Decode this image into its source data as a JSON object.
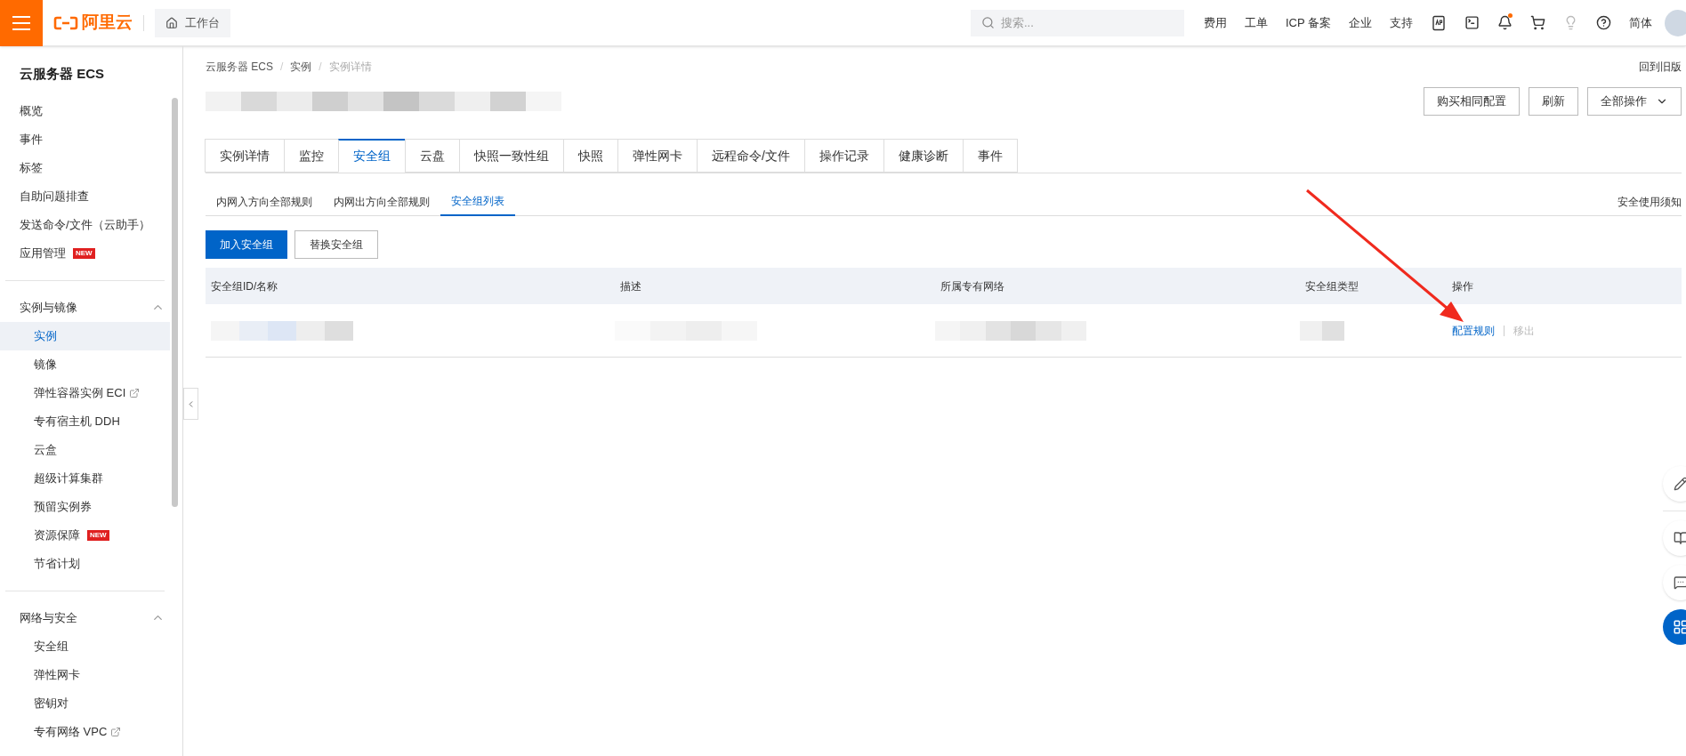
{
  "topbar": {
    "logo": "阿里云",
    "workbench": "工作台",
    "search": {
      "placeholder": "搜索..."
    },
    "links": [
      "费用",
      "工单",
      "ICP 备案",
      "企业",
      "支持"
    ],
    "lang": "简体",
    "lang_selected": true,
    "notification_dot": true
  },
  "sidebar": {
    "title": "云服务器 ECS",
    "items": [
      {
        "label": "概览",
        "external": false,
        "selected": false
      },
      {
        "label": "事件",
        "external": false,
        "selected": false
      },
      {
        "label": "标签",
        "external": false,
        "selected": false
      },
      {
        "label": "自助问题排查",
        "external": false,
        "selected": false
      },
      {
        "label": "发送命令/文件（云助手）",
        "external": false,
        "selected": false
      },
      {
        "label": "应用管理",
        "badge": "NEW",
        "external": false,
        "selected": false
      }
    ],
    "groups": [
      {
        "label": "实例与镜像",
        "expanded": true,
        "items": [
          {
            "label": "实例",
            "external": false,
            "selected": true
          },
          {
            "label": "镜像",
            "external": false,
            "selected": false
          },
          {
            "label": "弹性容器实例 ECI",
            "external": true,
            "selected": false
          },
          {
            "label": "专有宿主机 DDH",
            "external": false,
            "selected": false
          },
          {
            "label": "云盒",
            "external": false,
            "selected": false
          },
          {
            "label": "超级计算集群",
            "external": false,
            "selected": false
          },
          {
            "label": "预留实例券",
            "external": false,
            "selected": false
          },
          {
            "label": "资源保障",
            "badge": "NEW",
            "external": false,
            "selected": false
          },
          {
            "label": "节省计划",
            "external": false,
            "selected": false
          }
        ]
      },
      {
        "label": "网络与安全",
        "expanded": true,
        "items": [
          {
            "label": "安全组",
            "external": false,
            "selected": false
          },
          {
            "label": "弹性网卡",
            "external": false,
            "selected": false
          },
          {
            "label": "密钥对",
            "external": false,
            "selected": false
          },
          {
            "label": "专有网络 VPC",
            "external": true,
            "selected": false
          }
        ]
      }
    ]
  },
  "breadcrumb": [
    "云服务器 ECS",
    "实例",
    "实例详情"
  ],
  "breadcrumb_separator": "/",
  "back_link": "回到旧版",
  "header_buttons": [
    {
      "label": "购买相同配置",
      "kind": "plain"
    },
    {
      "label": "刷新",
      "kind": "plain"
    },
    {
      "label": "全部操作",
      "kind": "dropdown"
    }
  ],
  "tabs": [
    {
      "label": "实例详情",
      "selected": false
    },
    {
      "label": "监控",
      "selected": false
    },
    {
      "label": "安全组",
      "selected": true
    },
    {
      "label": "云盘",
      "selected": false
    },
    {
      "label": "快照一致性组",
      "selected": false
    },
    {
      "label": "快照",
      "selected": false
    },
    {
      "label": "弹性网卡",
      "selected": false
    },
    {
      "label": "远程命令/文件",
      "selected": false
    },
    {
      "label": "操作记录",
      "selected": false
    },
    {
      "label": "健康诊断",
      "selected": false
    },
    {
      "label": "事件",
      "selected": false
    }
  ],
  "subtabs": [
    {
      "label": "内网入方向全部规则",
      "selected": false
    },
    {
      "label": "内网出方向全部规则",
      "selected": false
    },
    {
      "label": "安全组列表",
      "selected": true
    }
  ],
  "notice_link": "安全使用须知",
  "actions": [
    {
      "label": "加入安全组",
      "kind": "primary"
    },
    {
      "label": "替换安全组",
      "kind": "plain"
    }
  ],
  "table": {
    "columns": [
      "安全组ID/名称",
      "描述",
      "所属专有网络",
      "安全组类型",
      "操作"
    ],
    "rows": [
      {
        "ops": [
          {
            "label": "配置规则",
            "disabled": false
          },
          {
            "label": "移出",
            "disabled": true
          }
        ]
      }
    ]
  }
}
